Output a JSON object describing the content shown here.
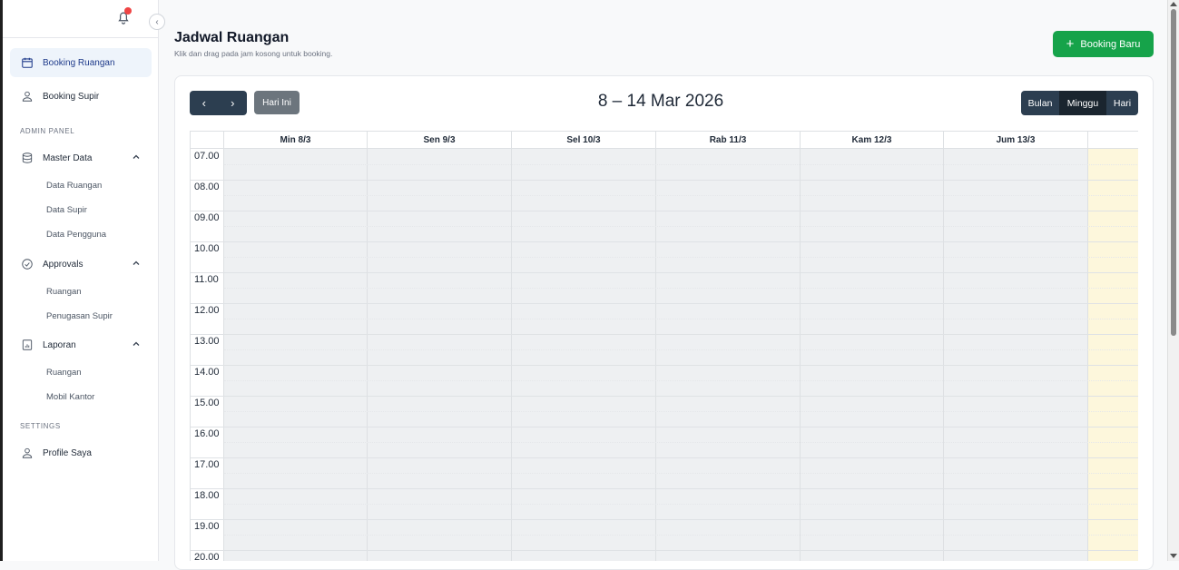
{
  "sidebar": {
    "collapse_glyph": "‹",
    "items": [
      {
        "label": "Booking Ruangan"
      },
      {
        "label": "Booking Supir"
      }
    ],
    "admin_label": "ADMIN PANEL",
    "master_data": {
      "label": "Master Data",
      "children": [
        "Data Ruangan",
        "Data Supir",
        "Data Pengguna"
      ]
    },
    "approvals": {
      "label": "Approvals",
      "children": [
        "Ruangan",
        "Penugasan Supir"
      ]
    },
    "laporan": {
      "label": "Laporan",
      "children": [
        "Ruangan",
        "Mobil Kantor"
      ]
    },
    "settings_label": "SETTINGS",
    "profile": {
      "label": "Profile Saya"
    }
  },
  "header": {
    "title": "Jadwal Ruangan",
    "subtitle": "Klik dan drag pada jam kosong untuk booking.",
    "new_booking_label": "Booking Baru",
    "new_booking_plus": "+",
    "accent": "#16a34a"
  },
  "toolbar": {
    "prev": "‹",
    "next": "›",
    "today_label": "Hari Ini",
    "range_title": "8 – 14 Mar 2026",
    "views": [
      "Bulan",
      "Minggu",
      "Hari"
    ],
    "active_view": "Minggu"
  },
  "calendar": {
    "days": [
      "Min 8/3",
      "Sen 9/3",
      "Sel 10/3",
      "Rab 11/3",
      "Kam 12/3",
      "Jum 13/3",
      ""
    ],
    "times": [
      "07.00",
      "08.00",
      "09.00",
      "10.00",
      "11.00",
      "12.00",
      "13.00",
      "14.00",
      "15.00",
      "16.00",
      "17.00",
      "18.00",
      "19.00",
      "20.00"
    ],
    "today_color": "#fdf7dc"
  }
}
